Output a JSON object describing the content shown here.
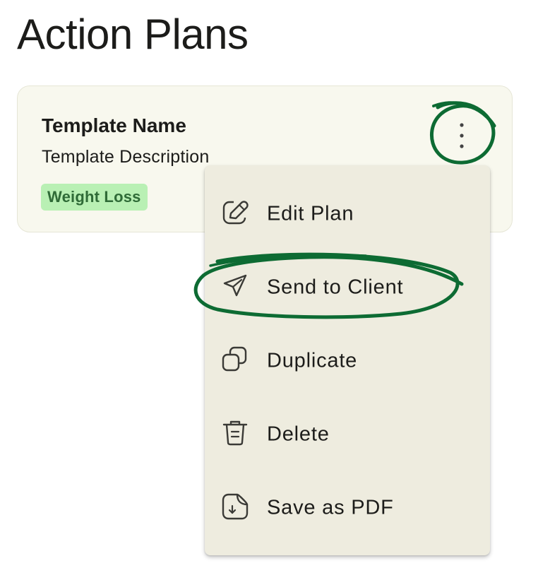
{
  "page": {
    "title": "Action Plans"
  },
  "card": {
    "name": "Template Name",
    "description": "Template Description",
    "tag": "Weight Loss",
    "more_icon": "more-vertical-icon"
  },
  "menu": {
    "items": [
      {
        "label": "Edit Plan",
        "icon": "edit-icon"
      },
      {
        "label": "Send to Client",
        "icon": "send-icon"
      },
      {
        "label": "Duplicate",
        "icon": "duplicate-icon"
      },
      {
        "label": "Delete",
        "icon": "trash-icon"
      },
      {
        "label": "Save as PDF",
        "icon": "file-download-icon"
      }
    ]
  },
  "colors": {
    "card_background": "#f8f8ee",
    "menu_background": "#eeecdf",
    "tag_background": "#b9f0b4",
    "tag_text": "#2f6b37",
    "annotation_green": "#0d6b33"
  }
}
